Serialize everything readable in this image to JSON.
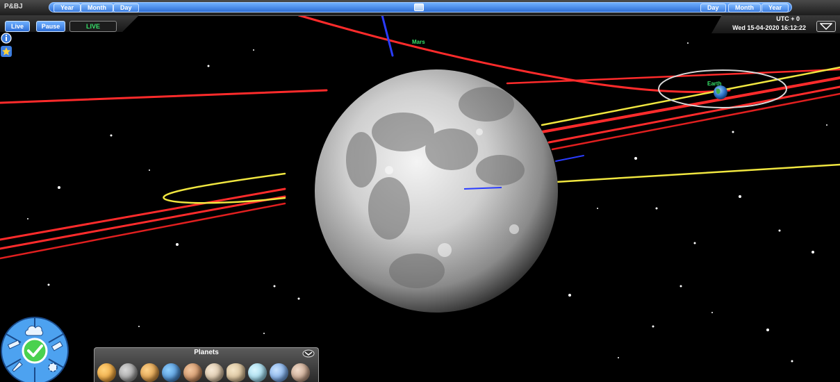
{
  "header": {
    "app_label": "P&BJ",
    "timeline_left": [
      "Year",
      "Month",
      "Day"
    ],
    "timeline_right": [
      "Day",
      "Month",
      "Year"
    ]
  },
  "controls": {
    "live_label": "Live",
    "pause_label": "Pause",
    "live_indicator": "LIVE"
  },
  "clock": {
    "timezone": "UTC + 0",
    "datetime": "Wed 15-04-2020 16:12:22"
  },
  "scene": {
    "planet_labels": [
      "Mars",
      "Earth"
    ]
  },
  "planets_panel": {
    "title": "Planets",
    "items": [
      "sun",
      "mercury",
      "venus",
      "earth",
      "mars",
      "jupiter",
      "saturn",
      "uranus",
      "neptune",
      "pluto"
    ]
  },
  "radial_menu": {
    "items": [
      "cloud-icon",
      "satellite-icon",
      "check-icon",
      "rocket-icon",
      "gear-icon",
      "telescope-icon"
    ]
  },
  "colors": {
    "orbit_red": "#ff2b2b",
    "orbit_yellow": "#f0e640",
    "accent_blue": "#3d7ee0",
    "live_green": "#36e36a"
  }
}
